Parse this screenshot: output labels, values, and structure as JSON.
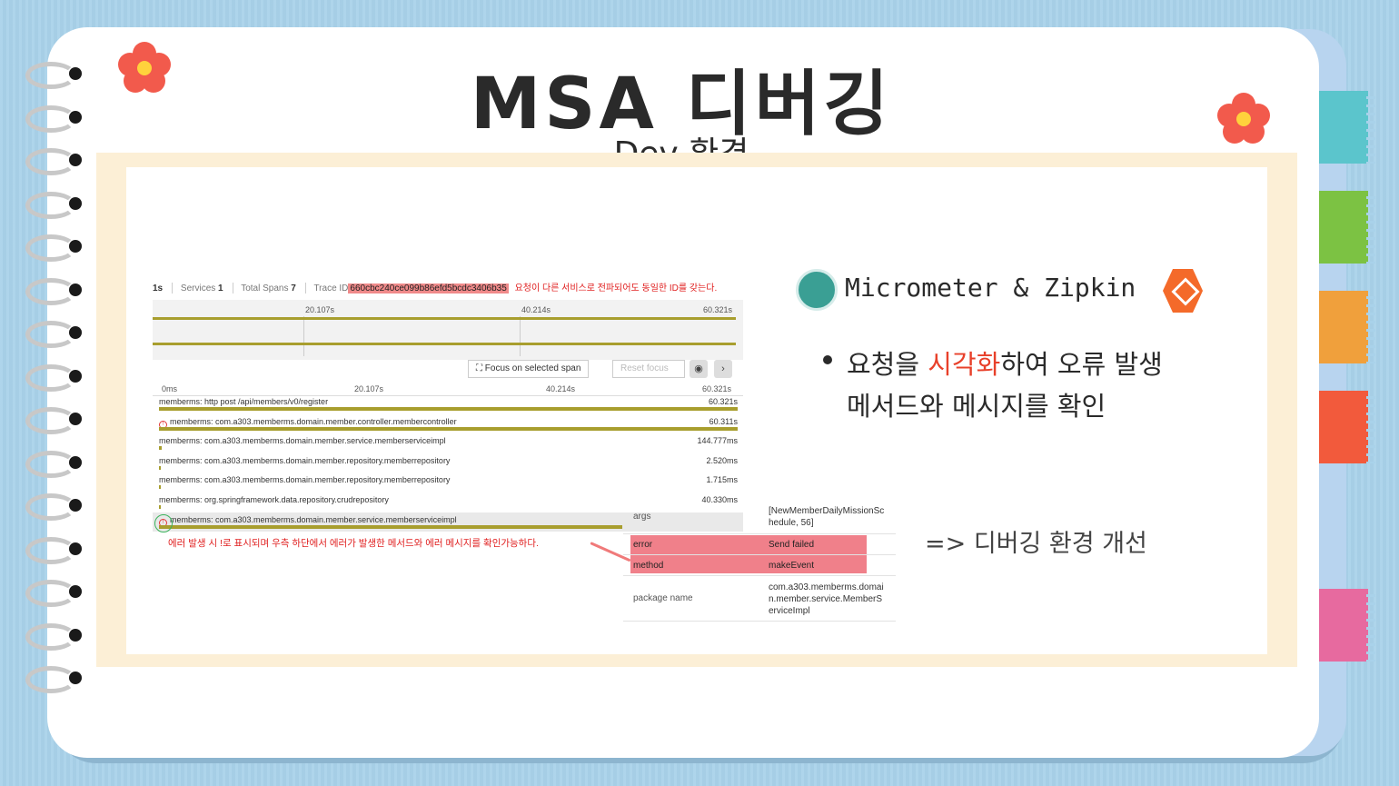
{
  "slide": {
    "title": "MSA 디버깅",
    "subtitle": "Dev 환경"
  },
  "zipkin": {
    "header": {
      "duration_fragment": "1s",
      "services_label": "Services",
      "services_value": "1",
      "spans_label": "Total Spans",
      "spans_value": "7",
      "trace_label": "Trace ID",
      "trace_id": "660cbc240ce099b86efd5bcdc3406b35",
      "note": "요청이 다른 서비스로 전파되어도 동일한 ID를 갖는다."
    },
    "minimap_ticks": [
      "20.107s",
      "40.214s",
      "60.321s"
    ],
    "toolbar": {
      "focus_label": "Focus on selected span",
      "reset_label": "Reset focus",
      "eye_icon": "eye-icon",
      "next_icon": "chevron-right-icon"
    },
    "axis": [
      "0ms",
      "20.107s",
      "40.214s",
      "60.321s"
    ],
    "spans": [
      {
        "name": "memberms: http post /api/members/v0/register",
        "duration": "60.321s",
        "fill": 1.0,
        "error": false,
        "selected": false
      },
      {
        "name": "memberms: com.a303.memberms.domain.member.controller.membercontroller",
        "duration": "60.311s",
        "fill": 1.0,
        "error": true,
        "selected": false
      },
      {
        "name": "memberms: com.a303.memberms.domain.member.service.memberserviceimpl",
        "duration": "144.777ms",
        "fill": 0.004,
        "error": false,
        "selected": false
      },
      {
        "name": "memberms: com.a303.memberms.domain.member.repository.memberrepository",
        "duration": "2.520ms",
        "fill": 0.002,
        "error": false,
        "selected": false
      },
      {
        "name": "memberms: com.a303.memberms.domain.member.repository.memberrepository",
        "duration": "1.715ms",
        "fill": 0.002,
        "error": false,
        "selected": false
      },
      {
        "name": "memberms: org.springframework.data.repository.crudrepository",
        "duration": "40.330ms",
        "fill": 0.002,
        "error": false,
        "selected": false
      },
      {
        "name": "memberms: com.a303.memberms.domain.member.service.memberserviceimpl",
        "duration": "",
        "fill": 0.8,
        "error": true,
        "selected": true
      }
    ],
    "error_note": "에러 발생 시 !로 표시되며 우측 하단에서 에러가 발생한 메서드와 에러 메시지를 확인가능하다."
  },
  "details": [
    {
      "key": "args",
      "value": "[NewMemberDailyMissionSchedule, 56]",
      "highlight": false
    },
    {
      "key": "error",
      "value": "Send failed",
      "highlight": true
    },
    {
      "key": "method",
      "value": "makeEvent",
      "highlight": true
    },
    {
      "key": "package name",
      "value": "com.a303.memberms.domain.member.service.MemberServiceImpl",
      "highlight": false
    }
  ],
  "right": {
    "heading": "Micrometer & Zipkin",
    "bullet_line1_pre": "요청을 ",
    "bullet_line1_accent": "시각화",
    "bullet_line1_post": "하여 오류 발생",
    "bullet_line2": "메서드와 메시지를 확인",
    "improvement": "=> 디버깅 환경 개선"
  },
  "colors": {
    "accent": "#e8402a",
    "span_bar": "#a89e2e",
    "highlight": "#f0808a",
    "background": "#a9d2ea"
  }
}
